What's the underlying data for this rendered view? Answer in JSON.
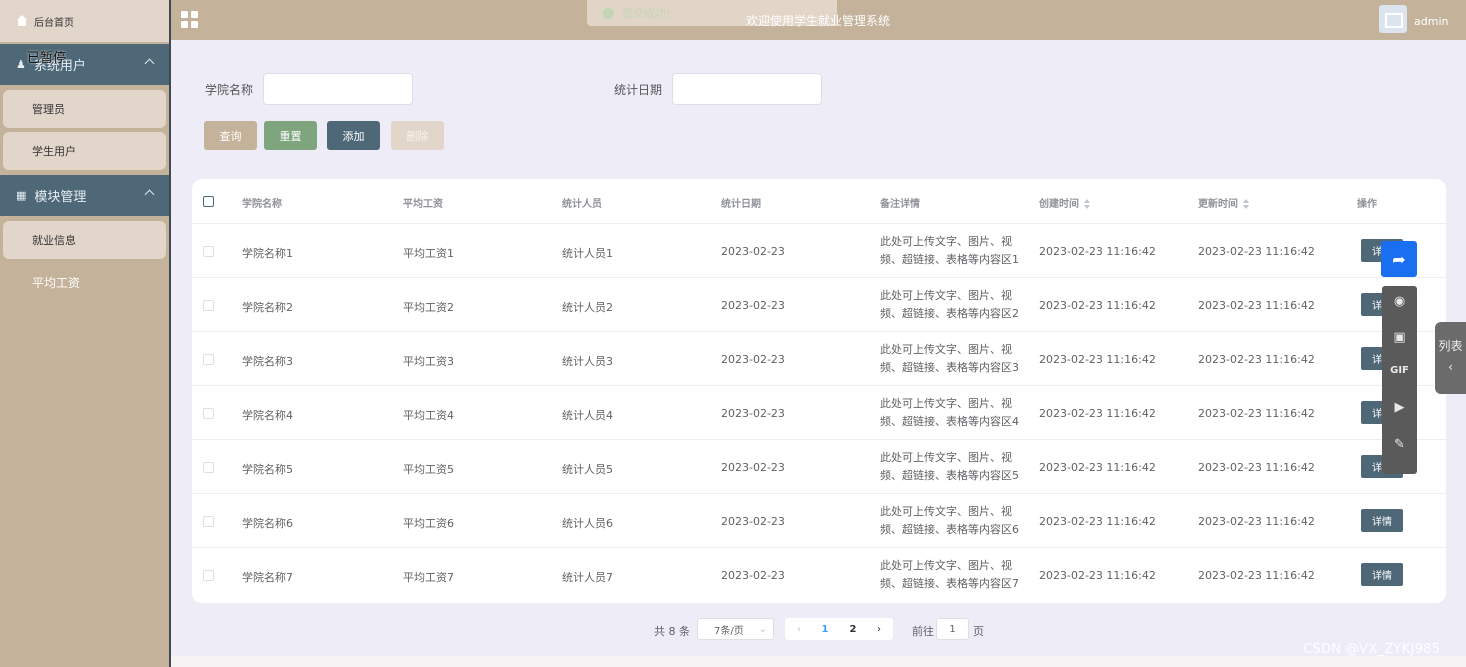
{
  "header": {
    "title": "欢迎使用学生就业管理系统",
    "toast": "提交成功!",
    "user": "admin"
  },
  "sidebar": {
    "home": "后台首页",
    "paused_overlay": "已暂停",
    "groups": [
      {
        "label": "系统用户",
        "items": [
          "管理员",
          "学生用户"
        ]
      },
      {
        "label": "模块管理",
        "items": [
          "就业信息",
          "平均工资"
        ]
      }
    ],
    "active_item": "平均工资"
  },
  "filters": {
    "college_label": "学院名称",
    "date_label": "统计日期",
    "college_value": "",
    "date_value": ""
  },
  "buttons": {
    "query": "查询",
    "reset": "重置",
    "add": "添加",
    "delete": "删除"
  },
  "colors": {
    "query": "#c4b29b",
    "reset": "#7ea57e",
    "add": "#4e6878",
    "delete": "#e2d6cb"
  },
  "table": {
    "columns": [
      "学院名称",
      "平均工资",
      "统计人员",
      "统计日期",
      "备注详情",
      "创建时间",
      "更新时间",
      "操作"
    ],
    "rows": [
      {
        "college": "学院名称1",
        "salary": "平均工资1",
        "staff": "统计人员1",
        "date": "2023-02-23",
        "note1": "此处可上传文字、图片、视",
        "note2": "频、超链接、表格等内容区1",
        "created": "2023-02-23 11:16:42",
        "updated": "2023-02-23 11:16:42",
        "action": "详情"
      },
      {
        "college": "学院名称2",
        "salary": "平均工资2",
        "staff": "统计人员2",
        "date": "2023-02-23",
        "note1": "此处可上传文字、图片、视",
        "note2": "频、超链接、表格等内容区2",
        "created": "2023-02-23 11:16:42",
        "updated": "2023-02-23 11:16:42",
        "action": "详情"
      },
      {
        "college": "学院名称3",
        "salary": "平均工资3",
        "staff": "统计人员3",
        "date": "2023-02-23",
        "note1": "此处可上传文字、图片、视",
        "note2": "频、超链接、表格等内容区3",
        "created": "2023-02-23 11:16:42",
        "updated": "2023-02-23 11:16:42",
        "action": "详情"
      },
      {
        "college": "学院名称4",
        "salary": "平均工资4",
        "staff": "统计人员4",
        "date": "2023-02-23",
        "note1": "此处可上传文字、图片、视",
        "note2": "频、超链接、表格等内容区4",
        "created": "2023-02-23 11:16:42",
        "updated": "2023-02-23 11:16:42",
        "action": "详情"
      },
      {
        "college": "学院名称5",
        "salary": "平均工资5",
        "staff": "统计人员5",
        "date": "2023-02-23",
        "note1": "此处可上传文字、图片、视",
        "note2": "频、超链接、表格等内容区5",
        "created": "2023-02-23 11:16:42",
        "updated": "2023-02-23 11:16:42",
        "action": "详情"
      },
      {
        "college": "学院名称6",
        "salary": "平均工资6",
        "staff": "统计人员6",
        "date": "2023-02-23",
        "note1": "此处可上传文字、图片、视",
        "note2": "频、超链接、表格等内容区6",
        "created": "2023-02-23 11:16:42",
        "updated": "2023-02-23 11:16:42",
        "action": "详情"
      },
      {
        "college": "学院名称7",
        "salary": "平均工资7",
        "staff": "统计人员7",
        "date": "2023-02-23",
        "note1": "此处可上传文字、图片、视",
        "note2": "频、超链接、表格等内容区7",
        "created": "2023-02-23 11:16:42",
        "updated": "2023-02-23 11:16:42",
        "action": "详情"
      }
    ]
  },
  "pagination": {
    "total": "共 8 条",
    "page_size": "7条/页",
    "pages": [
      "1",
      "2"
    ],
    "current_page": "1",
    "goto_label": "前往",
    "goto_value": "1",
    "goto_suffix": "页"
  },
  "overlay": {
    "side_tab": "列表",
    "gif_label": "GIF",
    "watermark": "CSDN @VX_ZYKJ985"
  }
}
